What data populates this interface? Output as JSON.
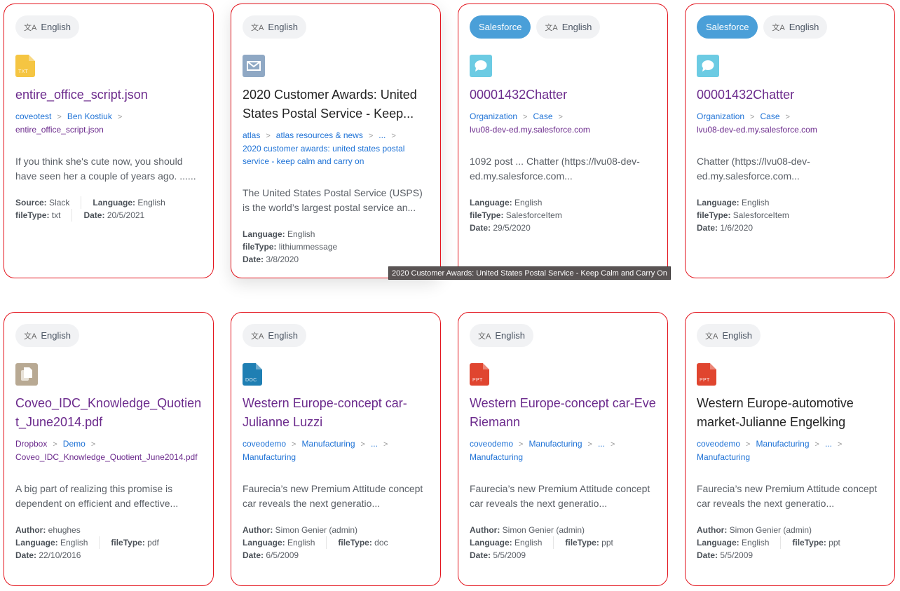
{
  "colors": {
    "card_border": "#e3141d",
    "title_visited": "#6b2a8c",
    "link_blue": "#1e72d6",
    "source_badge": "#4a9fd8",
    "txt_icon": "#f5c542",
    "email_icon": "#8fa8c4",
    "chatter_icon": "#6ccbe3",
    "pdf_icon": "#b8a993",
    "doc_icon": "#1f7fb3",
    "ppt_icon": "#e0452f"
  },
  "tooltip": "2020 Customer Awards: United States Postal Service - Keep Calm and Carry On",
  "cards": [
    {
      "badges": {
        "language": "English"
      },
      "icon": {
        "type": "txt-file-icon",
        "label": "TXT"
      },
      "title": "entire_office_script.json",
      "breadcrumbs": [
        "coveotest",
        "Ben Kostiuk"
      ],
      "breadcrumb_last": "entire_office_script.json",
      "excerpt": "If you think she's cute now, you should have seen her a couple of years ago. ......",
      "fields": {
        "source_label": "Source:",
        "source": "Slack",
        "language_label": "Language:",
        "language": "English",
        "filetype_label": "fileType:",
        "filetype": "txt",
        "date_label": "Date:",
        "date": "20/5/2021"
      }
    },
    {
      "badges": {
        "language": "English"
      },
      "icon": {
        "type": "email-icon"
      },
      "title": "2020 Customer Awards: United States Postal Service - Keep...",
      "breadcrumbs": [
        "atlas",
        "atlas resources & news",
        "..."
      ],
      "breadcrumb_last": "2020 customer awards: united states postal service - keep calm and carry on",
      "excerpt": "The United States Postal Service (USPS) is the world’s largest postal service an...",
      "fields": {
        "language_label": "Language:",
        "language": "English",
        "filetype_label": "fileType:",
        "filetype": "lithiummessage",
        "date_label": "Date:",
        "date": "3/8/2020"
      }
    },
    {
      "badges": {
        "source": "Salesforce",
        "language": "English"
      },
      "icon": {
        "type": "chat-bubble-icon"
      },
      "title": "00001432Chatter",
      "breadcrumbs": [
        "Organization",
        "Case"
      ],
      "breadcrumb_last": "lvu08-dev-ed.my.salesforce.com",
      "excerpt": "1092 post ... Chatter (https://lvu08-dev-ed.my.salesforce.com...",
      "fields": {
        "language_label": "Language:",
        "language": "English",
        "filetype_label": "fileType:",
        "filetype": "SalesforceItem",
        "date_label": "Date:",
        "date": "29/5/2020"
      }
    },
    {
      "badges": {
        "source": "Salesforce",
        "language": "English"
      },
      "icon": {
        "type": "chat-bubble-icon"
      },
      "title": "00001432Chatter",
      "breadcrumbs": [
        "Organization",
        "Case"
      ],
      "breadcrumb_last": "lvu08-dev-ed.my.salesforce.com",
      "excerpt": "Chatter (https://lvu08-dev-ed.my.salesforce.com...",
      "fields": {
        "language_label": "Language:",
        "language": "English",
        "filetype_label": "fileType:",
        "filetype": "SalesforceItem",
        "date_label": "Date:",
        "date": "1/6/2020"
      }
    },
    {
      "badges": {
        "language": "English"
      },
      "icon": {
        "type": "copy-pages-icon"
      },
      "title": "Coveo_IDC_Knowledge_Quotient_June2014.pdf",
      "breadcrumbs": [
        "Dropbox",
        "Demo"
      ],
      "breadcrumb_last": "Coveo_IDC_Knowledge_Quotient_June2014.pdf",
      "excerpt": "A big part of realizing this promise is dependent on efficient and effective...",
      "fields": {
        "author_label": "Author:",
        "author": "ehughes",
        "language_label": "Language:",
        "language": "English",
        "filetype_label": "fileType:",
        "filetype": "pdf",
        "date_label": "Date:",
        "date": "22/10/2016"
      }
    },
    {
      "badges": {
        "language": "English"
      },
      "icon": {
        "type": "doc-file-icon",
        "label": "DOC"
      },
      "title": "Western Europe-concept car-Julianne Luzzi",
      "breadcrumbs": [
        "coveodemo",
        "Manufacturing",
        "..."
      ],
      "breadcrumb_last": "Manufacturing",
      "excerpt": "Faurecia’s new Premium Attitude concept car reveals the next generatio...",
      "fields": {
        "author_label": "Author:",
        "author": "Simon Genier (admin)",
        "language_label": "Language:",
        "language": "English",
        "filetype_label": "fileType:",
        "filetype": "doc",
        "date_label": "Date:",
        "date": "6/5/2009"
      }
    },
    {
      "badges": {
        "language": "English"
      },
      "icon": {
        "type": "ppt-file-icon",
        "label": "PPT"
      },
      "title": "Western Europe-concept car-Eve Riemann",
      "breadcrumbs": [
        "coveodemo",
        "Manufacturing",
        "..."
      ],
      "breadcrumb_last": "Manufacturing",
      "excerpt": "Faurecia’s new Premium Attitude concept car reveals the next generatio...",
      "fields": {
        "author_label": "Author:",
        "author": "Simon Genier (admin)",
        "language_label": "Language:",
        "language": "English",
        "filetype_label": "fileType:",
        "filetype": "ppt",
        "date_label": "Date:",
        "date": "5/5/2009"
      }
    },
    {
      "badges": {
        "language": "English"
      },
      "icon": {
        "type": "ppt-file-icon",
        "label": "PPT"
      },
      "title": "Western Europe-automotive market-Julianne Engelking",
      "breadcrumbs": [
        "coveodemo",
        "Manufacturing",
        "..."
      ],
      "breadcrumb_last": "Manufacturing",
      "excerpt": "Faurecia’s new Premium Attitude concept car reveals the next generatio...",
      "fields": {
        "author_label": "Author:",
        "author": "Simon Genier (admin)",
        "language_label": "Language:",
        "language": "English",
        "filetype_label": "fileType:",
        "filetype": "ppt",
        "date_label": "Date:",
        "date": "5/5/2009"
      }
    }
  ]
}
